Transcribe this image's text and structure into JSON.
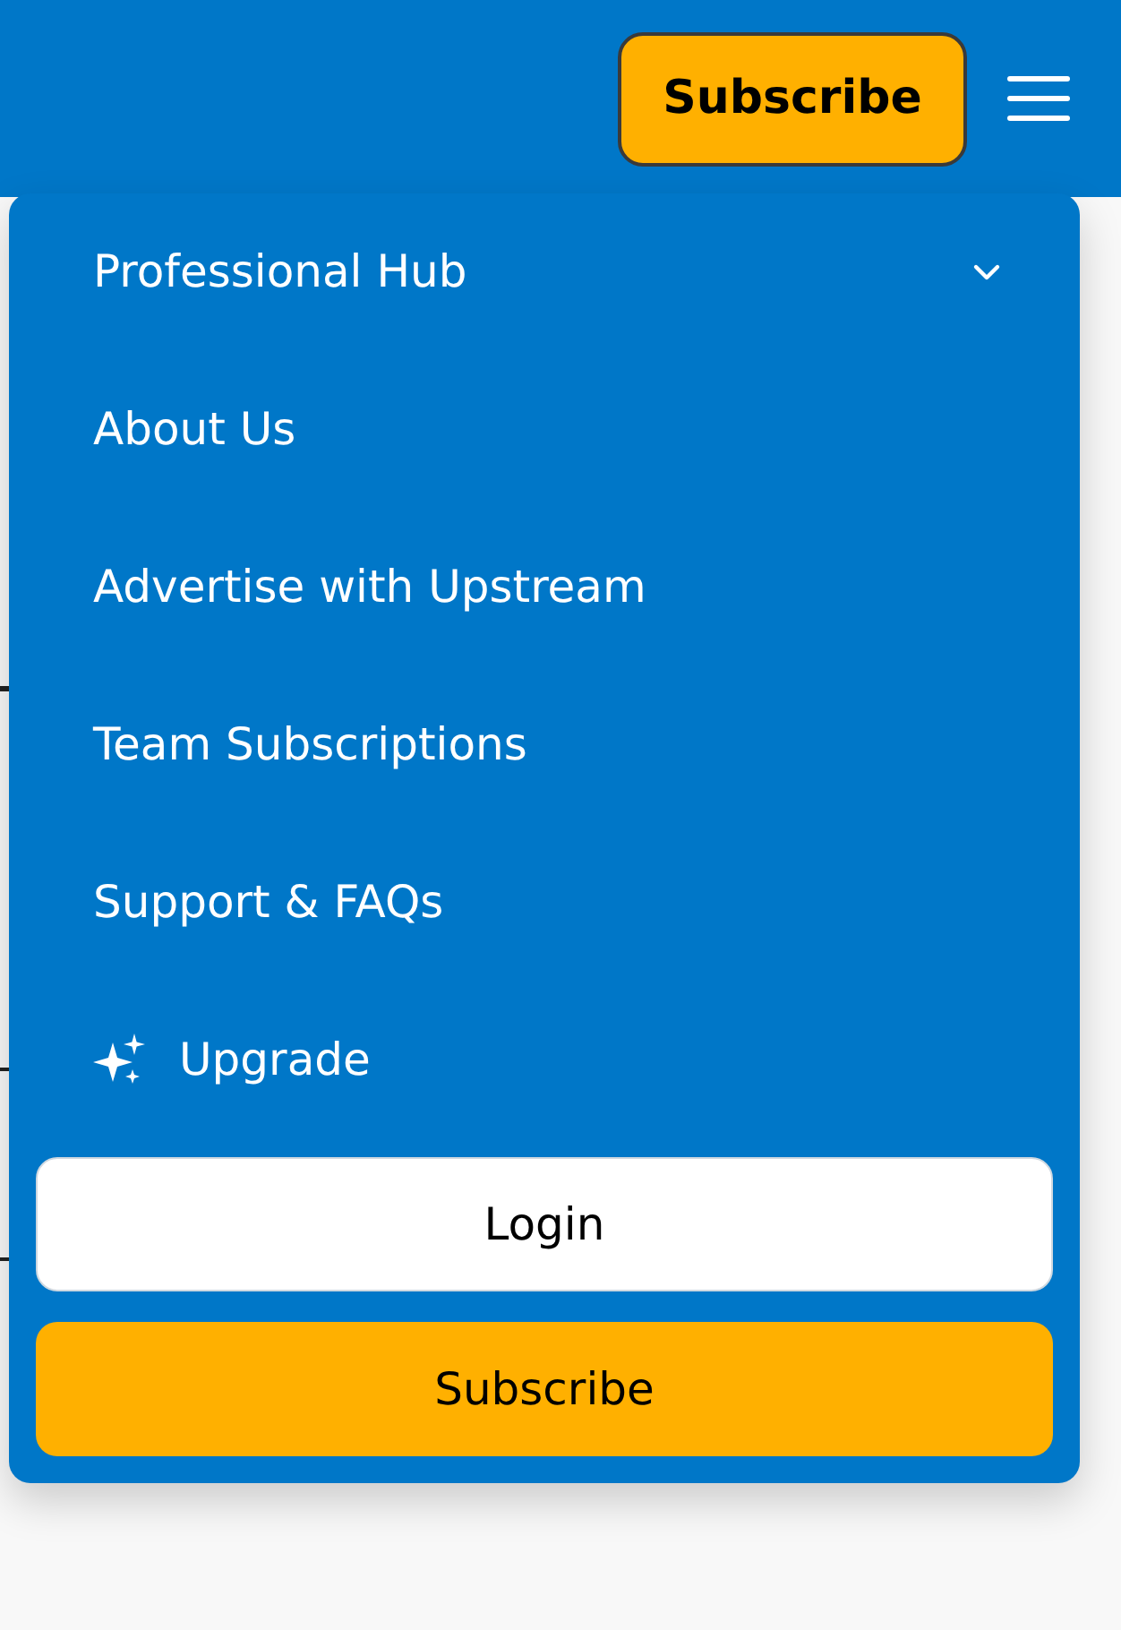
{
  "header": {
    "subscribe_button": "Subscribe"
  },
  "menu": {
    "items": [
      {
        "label": "Professional Hub",
        "kind": "submenu",
        "expanded": false
      },
      {
        "label": "About Us",
        "kind": "link"
      },
      {
        "label": "Advertise with Upstream",
        "kind": "link"
      },
      {
        "label": "Team Subscriptions",
        "kind": "link"
      },
      {
        "label": "Support & FAQs",
        "kind": "link"
      },
      {
        "label": "Upgrade",
        "kind": "upgrade"
      }
    ],
    "buttons": [
      {
        "label": "Login",
        "kind": "secondary"
      },
      {
        "label": "Subscribe",
        "kind": "primary"
      }
    ]
  }
}
